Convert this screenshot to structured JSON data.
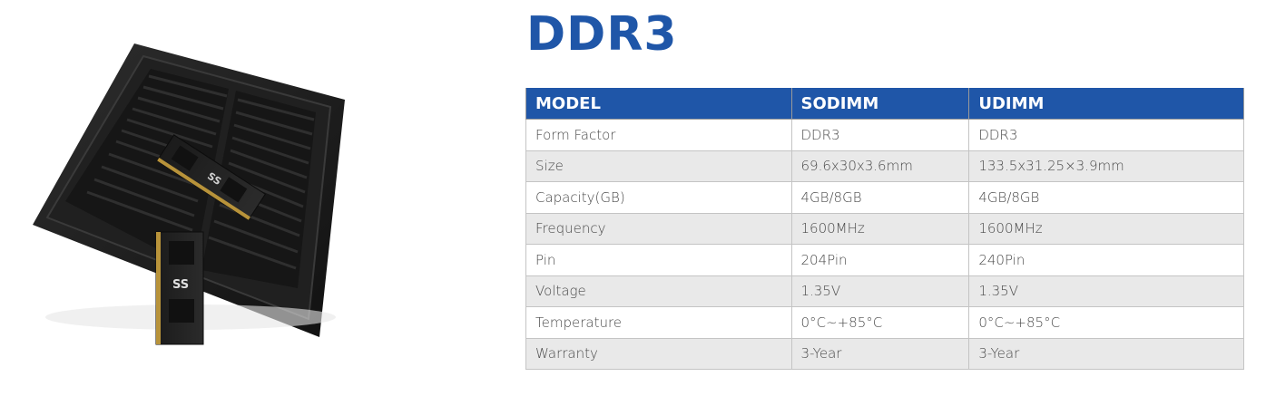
{
  "title": "DDR3",
  "table": {
    "headers": [
      "MODEL",
      "SODIMM",
      "UDIMM"
    ],
    "rows": [
      [
        "Form Factor",
        "DDR3",
        "DDR3"
      ],
      [
        "Size",
        "69.6x30x3.6mm",
        "133.5x31.25×3.9mm"
      ],
      [
        "Capacity(GB)",
        "4GB/8GB",
        "4GB/8GB"
      ],
      [
        "Frequency",
        "1600MHz",
        "1600MHz"
      ],
      [
        "Pin",
        "204Pin",
        "240Pin"
      ],
      [
        "Voltage",
        "1.35V",
        "1.35V"
      ],
      [
        "Temperature",
        "0°C~+85°C",
        "0°C~+85°C"
      ],
      [
        "Warranty",
        "3-Year",
        "3-Year"
      ]
    ]
  },
  "colors": {
    "accent": "#1f56a8",
    "row_alt": "#e9e9e9",
    "tray": "#1c1c1c"
  },
  "image": {
    "subject": "tray-of-ram-modules",
    "module_logo": "SS"
  }
}
